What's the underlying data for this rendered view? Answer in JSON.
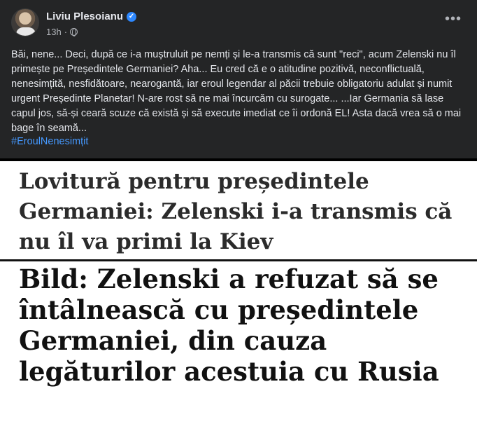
{
  "post": {
    "author_name": "Liviu Plesoianu",
    "timestamp": "13h",
    "separator": "·",
    "more_label": "•••",
    "body_text": "Băi, nene... Deci, după ce i-a muștruluit pe nemți și le-a transmis că sunt \"reci\", acum Zelenski nu îl primește pe Președintele Germaniei? Aha... Eu cred că e o atitudine pozitivă, neconflictuală, nenesimțită, nesfidătoare, nearogantă, iar eroul legendar al păcii trebuie obligatoriu adulat și numit urgent Președinte Planetar! N-are rost să ne mai încurcăm cu surogate... ...Iar Germania să lase capul jos, să-și ceară scuze că există și să execute imediat ce îi ordonă EL! Asta dacă vrea să o mai bage în seamă...",
    "hashtag": "#EroulNenesimțit"
  },
  "image": {
    "headline1": "Lovitură pentru președintele Germaniei: Zelenski i-a transmis că nu îl va primi la Kiev",
    "headline2": "Bild: Zelenski a refuzat să se întâlnească cu președintele Germaniei, din cauza legăturilor acestuia cu Rusia"
  },
  "colors": {
    "background": "#242526",
    "hashtag": "#4599ff",
    "verified": "#2d88ff"
  },
  "icons": [
    "verified-icon",
    "globe-icon",
    "more-options-icon"
  ]
}
